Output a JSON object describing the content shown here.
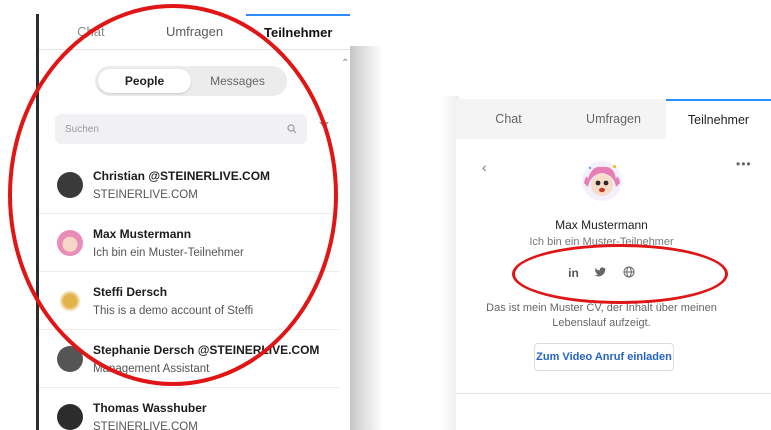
{
  "left": {
    "tabs": [
      "Chat",
      "Umfragen",
      "Teilnehmer"
    ],
    "segment": {
      "people": "People",
      "messages": "Messages"
    },
    "search": {
      "placeholder": "Suchen"
    },
    "people": [
      {
        "name": "Christian @STEINERLIVE.COM",
        "subtitle": "STEINERLIVE.COM",
        "avatar_color": "#3a3a3a"
      },
      {
        "name": "Max Mustermann",
        "subtitle": "Ich bin ein Muster-Teilnehmer",
        "avatar_color": "#e8a0c0"
      },
      {
        "name": "Steffi Dersch",
        "subtitle": "This is a demo account of Steffi",
        "avatar_color": "#d9a63a"
      },
      {
        "name": "Stephanie Dersch @STEINERLIVE.COM",
        "subtitle": "Management Assistant",
        "avatar_color": "#555555"
      },
      {
        "name": "Thomas Wasshuber",
        "subtitle": "STEINERLIVE.COM",
        "avatar_color": "#2c2c2c"
      }
    ]
  },
  "right": {
    "tabs": [
      "Chat",
      "Umfragen",
      "Teilnehmer"
    ],
    "name": "Max Mustermann",
    "tagline": "Ich bin ein Muster-Teilnehmer",
    "social": [
      "in",
      "█",
      "⊕"
    ],
    "social_icons": [
      "linkedin-icon",
      "twitter-icon",
      "globe-icon"
    ],
    "bio": "Das ist mein Muster CV, der Inhalt über meinen Lebenslauf aufzeigt.",
    "invite_label": "Zum Video Anruf einladen"
  },
  "colors": {
    "accent": "#2d8cff",
    "annotation": "#e01515",
    "link": "#2563c8"
  }
}
